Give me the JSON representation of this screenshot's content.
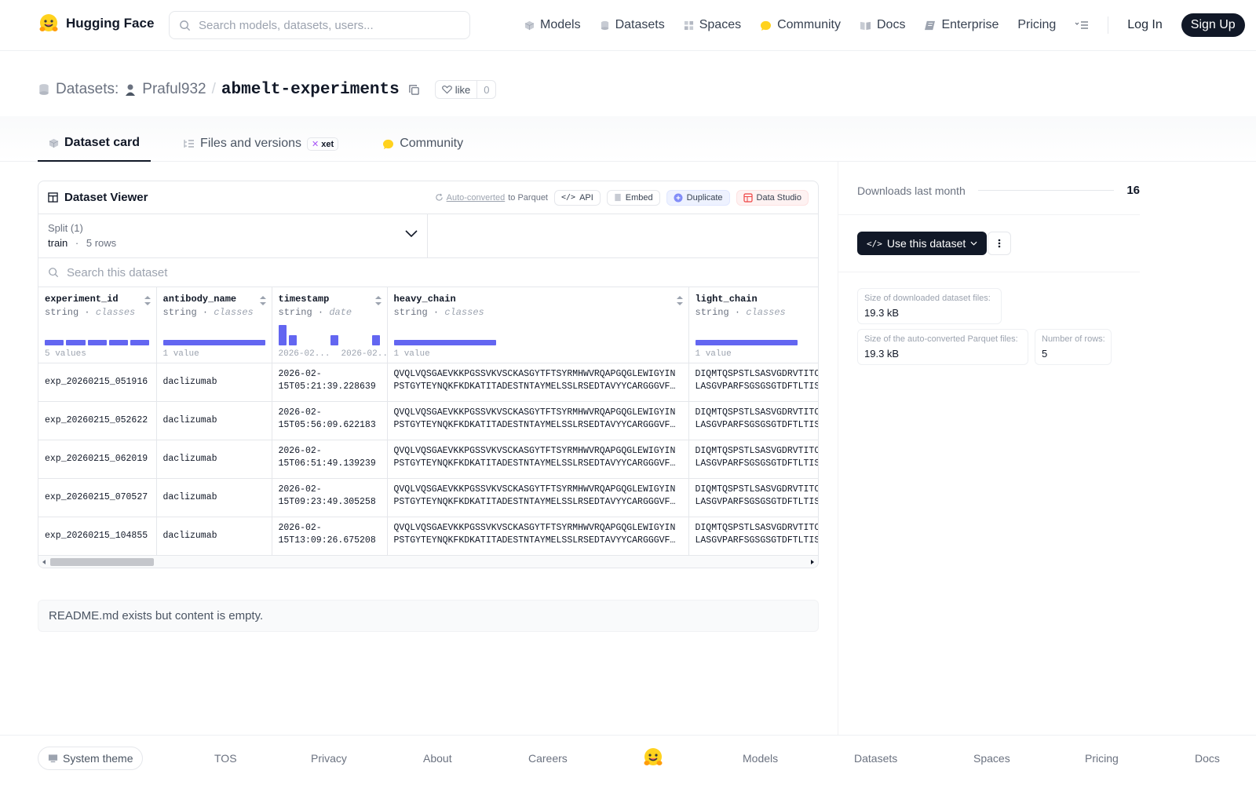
{
  "header": {
    "brand": "Hugging Face",
    "search_placeholder": "Search models, datasets, users...",
    "nav": [
      {
        "label": "Models"
      },
      {
        "label": "Datasets"
      },
      {
        "label": "Spaces"
      },
      {
        "label": "Community"
      },
      {
        "label": "Docs"
      },
      {
        "label": "Enterprise"
      },
      {
        "label": "Pricing"
      }
    ],
    "login": "Log In",
    "signup": "Sign Up"
  },
  "repo": {
    "kind_label": "Datasets:",
    "owner": "Praful932",
    "separator": "/",
    "name": "abmelt-experiments",
    "like_label": "like",
    "like_count": "0"
  },
  "tabs": [
    {
      "label": "Dataset card"
    },
    {
      "label": "Files and versions",
      "badge": "xet"
    },
    {
      "label": "Community"
    }
  ],
  "viewer": {
    "title": "Dataset Viewer",
    "auto_converted_link": "Auto-converted",
    "auto_converted_rest": "to Parquet",
    "actions": {
      "api": "API",
      "embed": "Embed",
      "duplicate": "Duplicate",
      "studio": "Data Studio"
    },
    "split_label": "Split (1)",
    "split_name": "train",
    "split_sep": "·",
    "split_rows": "5 rows",
    "search_placeholder": "Search this dataset",
    "columns": [
      {
        "name": "experiment_id",
        "type": "string",
        "kind": "classes",
        "caption": "5 values",
        "hist": [
          1,
          1,
          1,
          1,
          1
        ]
      },
      {
        "name": "antibody_name",
        "type": "string",
        "kind": "classes",
        "caption": "1 value",
        "hist": [
          1
        ]
      },
      {
        "name": "timestamp",
        "type": "string",
        "kind": "date",
        "caption": "2026-02...",
        "caption2": "2026-02...",
        "hist": [
          2,
          1,
          0,
          0,
          0,
          1,
          0,
          0,
          0,
          1
        ]
      },
      {
        "name": "heavy_chain",
        "type": "string",
        "kind": "classes",
        "caption": "1 value",
        "hist": [
          1
        ]
      },
      {
        "name": "light_chain",
        "type": "string",
        "kind": "classes",
        "caption": "1 value",
        "hist": [
          1
        ]
      }
    ],
    "rows": [
      {
        "experiment_id": "exp_20260215_051916",
        "antibody_name": "daclizumab",
        "ts1": "2026-02-",
        "ts2": "15T05:21:39.228639",
        "h1": "QVQLVQSGAEVKKPGSSVKVSCKASGYTFTSYRMHWVRQAPGQGLEWIGYIN",
        "h2": "PSTGYTEYNQKFKDKATITADESTNTAYMELSSLRSEDTAVYYCARGGGVF…",
        "l1": "DIQMTQSPSTLSASVGDRVTITC",
        "l2": "LASGVPARFSGSGSGTDFTLTIS"
      },
      {
        "experiment_id": "exp_20260215_052622",
        "antibody_name": "daclizumab",
        "ts1": "2026-02-",
        "ts2": "15T05:56:09.622183",
        "h1": "QVQLVQSGAEVKKPGSSVKVSCKASGYTFTSYRMHWVRQAPGQGLEWIGYIN",
        "h2": "PSTGYTEYNQKFKDKATITADESTNTAYMELSSLRSEDTAVYYCARGGGVF…",
        "l1": "DIQMTQSPSTLSASVGDRVTITC",
        "l2": "LASGVPARFSGSGSGTDFTLTIS"
      },
      {
        "experiment_id": "exp_20260215_062019",
        "antibody_name": "daclizumab",
        "ts1": "2026-02-",
        "ts2": "15T06:51:49.139239",
        "h1": "QVQLVQSGAEVKKPGSSVKVSCKASGYTFTSYRMHWVRQAPGQGLEWIGYIN",
        "h2": "PSTGYTEYNQKFKDKATITADESTNTAYMELSSLRSEDTAVYYCARGGGVF…",
        "l1": "DIQMTQSPSTLSASVGDRVTITC",
        "l2": "LASGVPARFSGSGSGTDFTLTIS"
      },
      {
        "experiment_id": "exp_20260215_070527",
        "antibody_name": "daclizumab",
        "ts1": "2026-02-",
        "ts2": "15T09:23:49.305258",
        "h1": "QVQLVQSGAEVKKPGSSVKVSCKASGYTFTSYRMHWVRQAPGQGLEWIGYIN",
        "h2": "PSTGYTEYNQKFKDKATITADESTNTAYMELSSLRSEDTAVYYCARGGGVF…",
        "l1": "DIQMTQSPSTLSASVGDRVTITC",
        "l2": "LASGVPARFSGSGSGTDFTLTIS"
      },
      {
        "experiment_id": "exp_20260215_104855",
        "antibody_name": "daclizumab",
        "ts1": "2026-02-",
        "ts2": "15T13:09:26.675208",
        "h1": "QVQLVQSGAEVKKPGSSVKVSCKASGYTFTSYRMHWVRQAPGQGLEWIGYIN",
        "h2": "PSTGYTEYNQKFKDKATITADESTNTAYMELSSLRSEDTAVYYCARGGGVF…",
        "l1": "DIQMTQSPSTLSASVGDRVTITC",
        "l2": "LASGVPARFSGSGSGTDFTLTIS"
      }
    ]
  },
  "readme_message": "README.md exists but content is empty.",
  "sidebar": {
    "downloads_label": "Downloads last month",
    "downloads_value": "16",
    "use_dataset": "Use this dataset",
    "stats": [
      {
        "label": "Size of downloaded dataset files:",
        "value": "19.3 kB"
      },
      {
        "label": "Size of the auto-converted Parquet files:",
        "value": "19.3 kB"
      },
      {
        "label": "Number of rows:",
        "value": "5"
      }
    ]
  },
  "footer": {
    "theme": "System theme",
    "links": [
      "TOS",
      "Privacy",
      "About",
      "Careers",
      "Models",
      "Datasets",
      "Spaces",
      "Pricing",
      "Docs"
    ]
  },
  "colors": {
    "accent": "#6366f1",
    "dark": "#111827",
    "brand_yellow": "#FFD21E"
  }
}
